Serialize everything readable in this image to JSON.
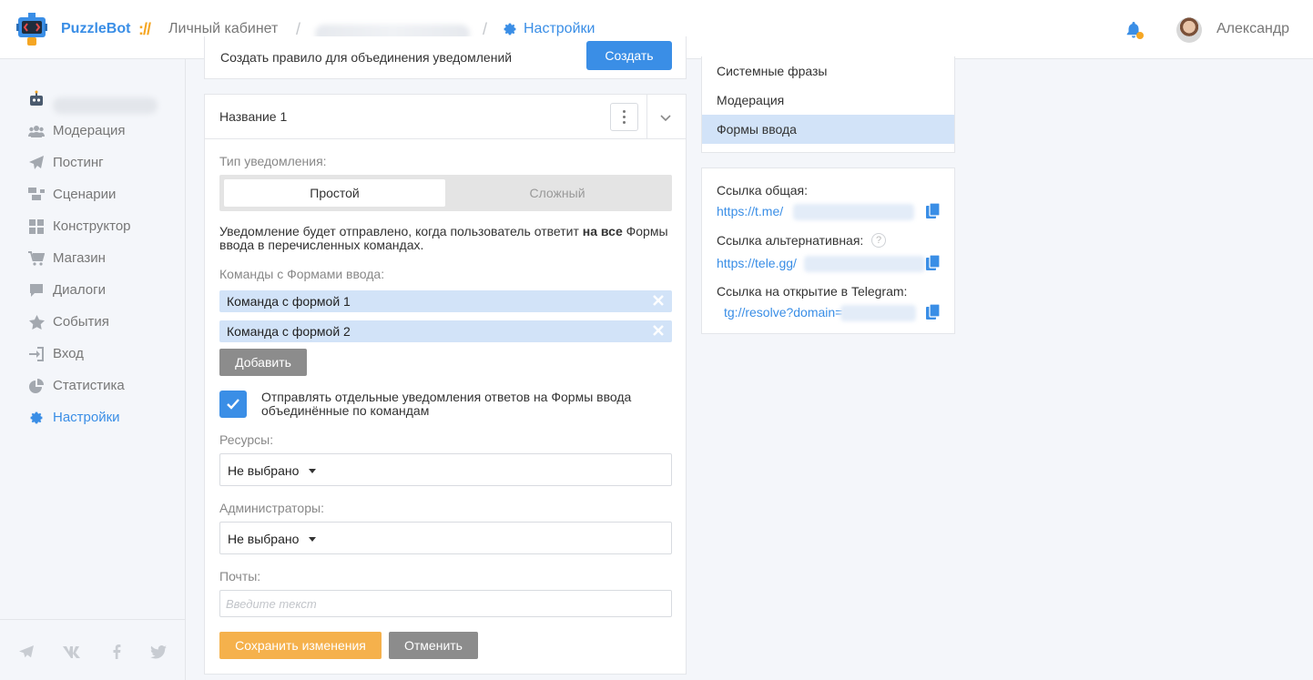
{
  "header": {
    "brand": "PuzzleBot",
    "brand_separator": "://",
    "breadcrumb_cabinet": "Личный кабинет",
    "breadcrumb_sep": "/",
    "breadcrumb_settings": "Настройки",
    "user_name": "Александр",
    "accent_color": "#3a8ee6",
    "notification_dot_color": "#f5a623"
  },
  "sidebar": {
    "items": [
      {
        "label": "Модерация",
        "icon": "users-icon"
      },
      {
        "label": "Постинг",
        "icon": "paper-plane-icon"
      },
      {
        "label": "Сценарии",
        "icon": "scenario-icon"
      },
      {
        "label": "Конструктор",
        "icon": "grid-icon"
      },
      {
        "label": "Магазин",
        "icon": "cart-icon"
      },
      {
        "label": "Диалоги",
        "icon": "chat-icon"
      },
      {
        "label": "События",
        "icon": "star-icon"
      },
      {
        "label": "Вход",
        "icon": "sign-in-icon"
      },
      {
        "label": "Статистика",
        "icon": "pie-chart-icon"
      },
      {
        "label": "Настройки",
        "icon": "gear-icon",
        "active": true
      }
    ],
    "socials": [
      "telegram-icon",
      "vk-icon",
      "facebook-icon",
      "twitter-icon"
    ]
  },
  "top_card": {
    "text": "Создать правило для объединения уведомлений",
    "button": "Создать"
  },
  "rule": {
    "title": "Название 1",
    "type_label": "Тип уведомления:",
    "type_options": [
      "Простой",
      "Сложный"
    ],
    "type_selected": "Простой",
    "description_pre": "Уведомление будет отправлено, когда пользователь ответит ",
    "description_bold": "на все",
    "description_post": " Формы ввода в перечисленных командах.",
    "commands_label": "Команды с Формами ввода:",
    "commands": [
      "Команда с формой 1",
      "Команда с формой 2"
    ],
    "add_button": "Добавить",
    "separate_checkbox_text": "Отправлять отдельные уведомления ответов на Формы ввода объединённые по командам",
    "separate_checked": true,
    "resources_label": "Ресурсы:",
    "resources_value": "Не выбрано",
    "admins_label": "Администраторы:",
    "admins_value": "Не выбрано",
    "emails_label": "Почты:",
    "emails_placeholder": "Введите текст",
    "save_button": "Сохранить изменения",
    "cancel_button": "Отменить"
  },
  "right_menu": {
    "items": [
      {
        "label": "Системные фразы"
      },
      {
        "label": "Модерация"
      },
      {
        "label": "Формы ввода",
        "active": true
      }
    ]
  },
  "links": {
    "general_label": "Ссылка общая:",
    "general_url": "https://t.me/",
    "alt_label": "Ссылка альтернативная:",
    "alt_url": "https://tele.gg/",
    "tg_label": "Ссылка на открытие в Telegram:",
    "tg_url": "tg://resolve?domain="
  }
}
